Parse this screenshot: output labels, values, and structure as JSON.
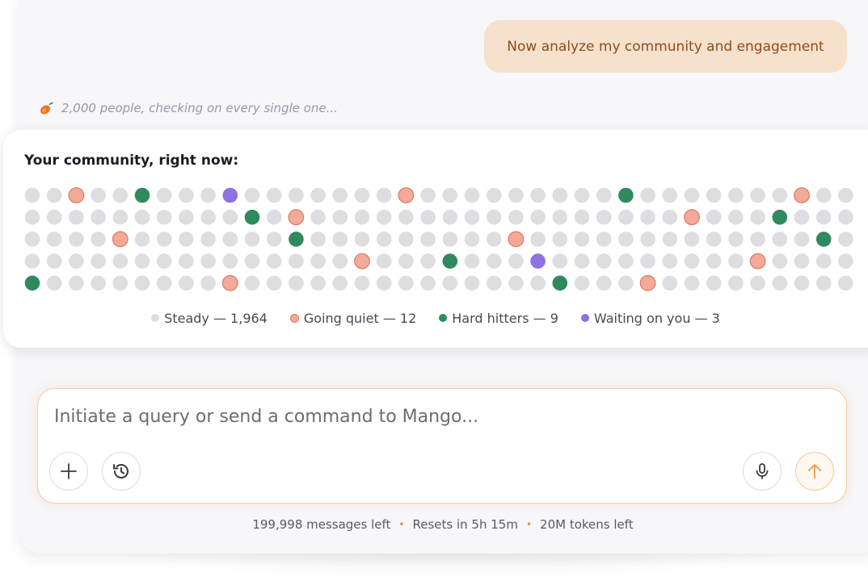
{
  "chat": {
    "user_message": "Now analyze my community and engagement",
    "status_text": "2,000 people, checking on every single one..."
  },
  "community_card": {
    "title": "Your community, right now:",
    "colors": {
      "steady": "#dedde1",
      "going_quiet": "#f3aa98",
      "going_quiet_border": "#e0785f",
      "hard_hitters": "#2f8a5e",
      "waiting_on_you": "#8e72e3"
    },
    "grid_rows": [
      "..q..h...w.......q.........h.......q....",
      "..........h.q.................q...h...w..",
      "....q.......h.........q.............h.q.",
      "...............q...h...w.........q......",
      "h........q..............h...q..........."
    ],
    "legend": [
      {
        "key": "steady",
        "label": "Steady — 1,964"
      },
      {
        "key": "going_quiet",
        "label": "Going quiet — 12"
      },
      {
        "key": "hard_hitters",
        "label": "Hard hitters — 9"
      },
      {
        "key": "waiting_on_you",
        "label": "Waiting on you — 3"
      }
    ]
  },
  "composer": {
    "placeholder": "Initiate a query or send a command to Mango...",
    "value": "",
    "accent": "#f0a25a"
  },
  "footer": {
    "messages_left": "199,998 messages left",
    "resets": "Resets in 5h 15m",
    "tokens_left": "20M tokens left"
  }
}
